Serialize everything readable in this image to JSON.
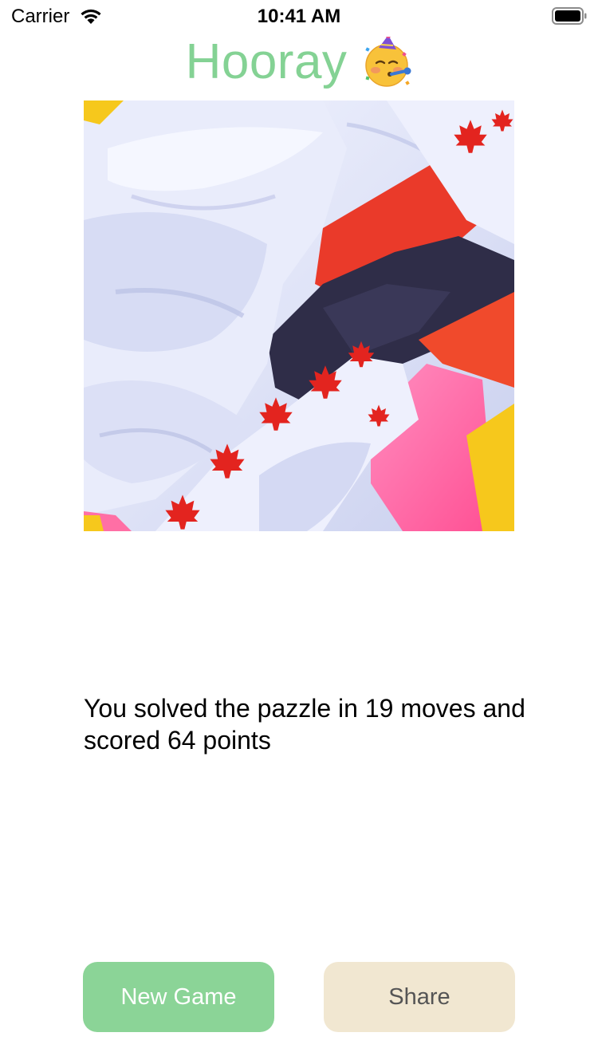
{
  "status_bar": {
    "carrier": "Carrier",
    "time": "10:41 AM",
    "wifi_icon": "wifi-icon",
    "battery_icon": "battery-icon"
  },
  "header": {
    "title": "Hooray",
    "emoji_icon": "party-face-icon",
    "title_color": "#84d294"
  },
  "puzzle": {
    "image_icon": "solved-puzzle-image",
    "description_colors": [
      "#e6e9fa",
      "#e8312b",
      "#2d2b45",
      "#ff6fa5",
      "#f7c51e"
    ]
  },
  "result": {
    "text": "You solved the pazzle in 19 moves and scored 64 points",
    "moves": 19,
    "points": 64
  },
  "buttons": {
    "new_game": "New Game",
    "share": "Share",
    "new_game_color": "#8bd497",
    "share_color": "#f1e7d1"
  }
}
